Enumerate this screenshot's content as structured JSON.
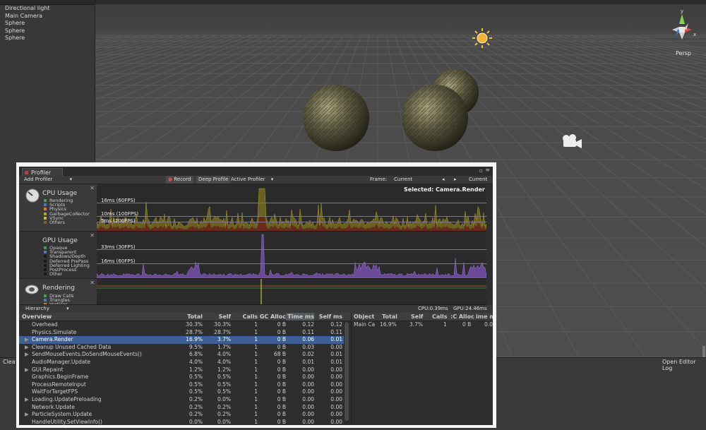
{
  "hierarchy": {
    "items": [
      "Directional light",
      "Main Camera",
      "Sphere",
      "Sphere",
      "Sphere"
    ]
  },
  "scene": {
    "persp_label": "Persp",
    "axis_labels": {
      "y": "y",
      "x": "x"
    }
  },
  "console": {
    "clear_label": "Clea",
    "open_editor_log_label": "Open Editor Log"
  },
  "profiler": {
    "tab_label": "Profiler",
    "toolbar": {
      "add_profiler": "Add Profiler",
      "record": "Record",
      "deep_profile": "Deep Profile",
      "active_profiler": "Active Profiler",
      "frame_label": "Frame:",
      "frame_value": "Current",
      "current_button": "Current"
    },
    "selected_label": "Selected: Camera.Render",
    "cpu": {
      "title": "CPU Usage",
      "legend": [
        {
          "name": "Rendering",
          "color": "#4f9b4f"
        },
        {
          "name": "Scripts",
          "color": "#4a78c4"
        },
        {
          "name": "Physics",
          "color": "#d87a2d"
        },
        {
          "name": "GarbageCollector",
          "color": "#a8a830"
        },
        {
          "name": "VSync",
          "color": "#c8b84a"
        },
        {
          "name": "Others",
          "color": "#8c5a3c"
        }
      ],
      "ref_lines": [
        "16ms (60FPS)",
        "10ms (100FPS)",
        "5ms (200FPS)"
      ]
    },
    "gpu": {
      "title": "GPU Usage",
      "legend": [
        {
          "name": "Opaque",
          "color": "#4f9b4f"
        },
        {
          "name": "Transparent",
          "color": "#4a78c4"
        },
        {
          "name": "Shadows/Depth",
          "color": "#1a1a1a"
        },
        {
          "name": "Deferred PrePass",
          "color": "#1a1a1a"
        },
        {
          "name": "Deferred Lighting",
          "color": "#1a1a1a"
        },
        {
          "name": "PostProcess",
          "color": "#1a1a1a"
        },
        {
          "name": "Other",
          "color": "#1a1a1a"
        }
      ],
      "ref_lines": [
        "33ms (30FPS)",
        "16ms (60FPS)"
      ]
    },
    "rendering": {
      "title": "Rendering",
      "legend": [
        {
          "name": "Draw Calls",
          "color": "#4f9b4f"
        },
        {
          "name": "Triangles",
          "color": "#4a78c4"
        },
        {
          "name": "Vertices",
          "color": "#d87a2d"
        }
      ]
    },
    "hierarchy_bar": {
      "mode": "Hierarchy",
      "cpu_time": "CPU:0.39ms",
      "gpu_time": "GPU:24.46ms"
    },
    "table": {
      "headers": [
        "Overview",
        "Total",
        "Self",
        "Calls",
        "GC Alloc",
        "Time ms",
        "Self ms"
      ],
      "rows": [
        {
          "name": "Overhead",
          "expand": false,
          "total": "30.3%",
          "self": "30.3%",
          "calls": "1",
          "gc": "0 B",
          "time": "0.12",
          "selfms": "0.12"
        },
        {
          "name": "Physics.Simulate",
          "expand": false,
          "total": "28.7%",
          "self": "28.7%",
          "calls": "1",
          "gc": "0 B",
          "time": "0.11",
          "selfms": "0.11"
        },
        {
          "name": "Camera.Render",
          "expand": true,
          "total": "16.9%",
          "self": "3.7%",
          "calls": "1",
          "gc": "0 B",
          "time": "0.06",
          "selfms": "0.01",
          "selected": true
        },
        {
          "name": "Cleanup Unused Cached Data",
          "expand": true,
          "total": "9.5%",
          "self": "1.7%",
          "calls": "1",
          "gc": "0 B",
          "time": "0.03",
          "selfms": "0.00"
        },
        {
          "name": "SendMouseEvents.DoSendMouseEvents()",
          "expand": true,
          "total": "6.8%",
          "self": "4.0%",
          "calls": "1",
          "gc": "68 B",
          "time": "0.02",
          "selfms": "0.01"
        },
        {
          "name": "AudioManager.Update",
          "expand": false,
          "total": "4.0%",
          "self": "4.0%",
          "calls": "1",
          "gc": "0 B",
          "time": "0.01",
          "selfms": "0.01"
        },
        {
          "name": "GUI.Repaint",
          "expand": true,
          "total": "1.2%",
          "self": "1.2%",
          "calls": "1",
          "gc": "0 B",
          "time": "0.00",
          "selfms": "0.00"
        },
        {
          "name": "Graphics.BeginFrame",
          "expand": false,
          "total": "0.5%",
          "self": "0.5%",
          "calls": "1",
          "gc": "0 B",
          "time": "0.00",
          "selfms": "0.00"
        },
        {
          "name": "ProcessRemoteInput",
          "expand": false,
          "total": "0.5%",
          "self": "0.5%",
          "calls": "1",
          "gc": "0 B",
          "time": "0.00",
          "selfms": "0.00"
        },
        {
          "name": "WaitForTargetFPS",
          "expand": false,
          "total": "0.5%",
          "self": "0.5%",
          "calls": "1",
          "gc": "0 B",
          "time": "0.00",
          "selfms": "0.00"
        },
        {
          "name": "Loading.UpdatePreloading",
          "expand": true,
          "total": "0.2%",
          "self": "0.0%",
          "calls": "1",
          "gc": "0 B",
          "time": "0.00",
          "selfms": "0.00"
        },
        {
          "name": "Network.Update",
          "expand": false,
          "total": "0.2%",
          "self": "0.2%",
          "calls": "1",
          "gc": "0 B",
          "time": "0.00",
          "selfms": "0.00"
        },
        {
          "name": "ParticleSystem.Update",
          "expand": true,
          "total": "0.2%",
          "self": "0.2%",
          "calls": "1",
          "gc": "0 B",
          "time": "0.00",
          "selfms": "0.00"
        },
        {
          "name": "HandleUtility.SetViewInfo()",
          "expand": false,
          "total": "0.0%",
          "self": "0.0%",
          "calls": "1",
          "gc": "0 B",
          "time": "0.00",
          "selfms": "0.00"
        }
      ]
    },
    "object_pane": {
      "headers": [
        "Object",
        "Total",
        "Self",
        "Calls",
        "GC Alloc",
        "Time ms"
      ],
      "header_display": [
        "Object",
        "Total",
        "Self",
        "Calls",
        ":C Alloc",
        "ime m"
      ],
      "row": {
        "object": "Main Ca",
        "total": "16.9%",
        "self": "3.7%",
        "calls": "1",
        "gc": "0 B",
        "time": "0.0"
      }
    }
  }
}
